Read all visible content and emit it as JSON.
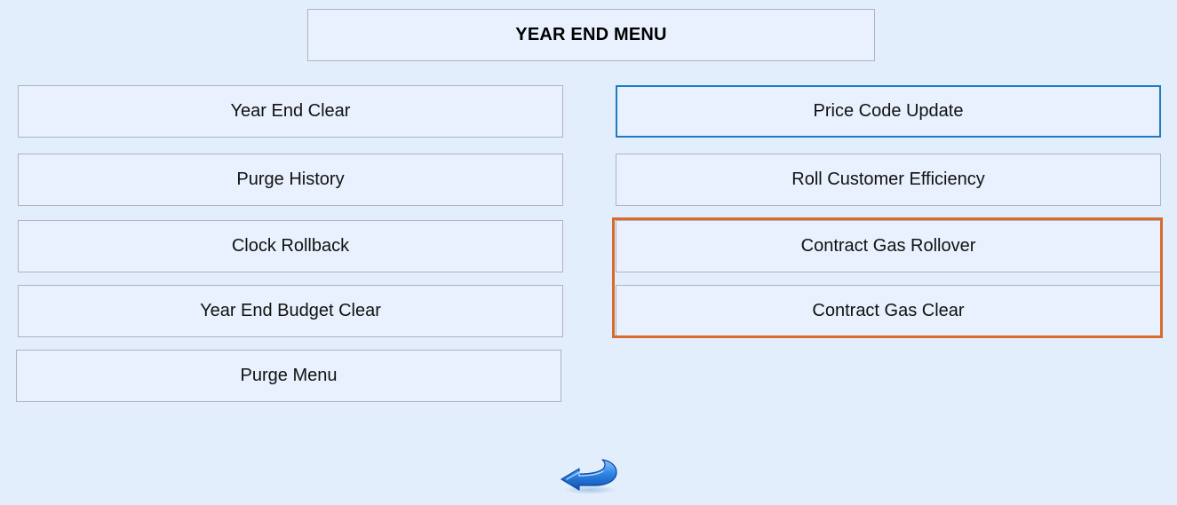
{
  "menu": {
    "title": "YEAR END MENU"
  },
  "left_buttons": [
    {
      "label": "Year End Clear"
    },
    {
      "label": "Purge History"
    },
    {
      "label": "Clock Rollback"
    },
    {
      "label": "Year End Budget Clear"
    },
    {
      "label": "Purge Menu"
    }
  ],
  "right_buttons": [
    {
      "label": "Price Code Update",
      "state": "focused"
    },
    {
      "label": "Roll Customer Efficiency"
    },
    {
      "label": "Contract Gas Rollover",
      "state": "highlighted"
    },
    {
      "label": "Contract Gas Clear",
      "state": "highlighted"
    }
  ],
  "back": {
    "icon": "back-arrow-icon"
  },
  "colors": {
    "background": "#e2eefc",
    "button_fill": "#e8f1fd",
    "button_border": "#aeb4bb",
    "focus_border": "#1f7ac2",
    "highlight_border": "#d9692d",
    "arrow_blue": "#1f6fd0"
  }
}
